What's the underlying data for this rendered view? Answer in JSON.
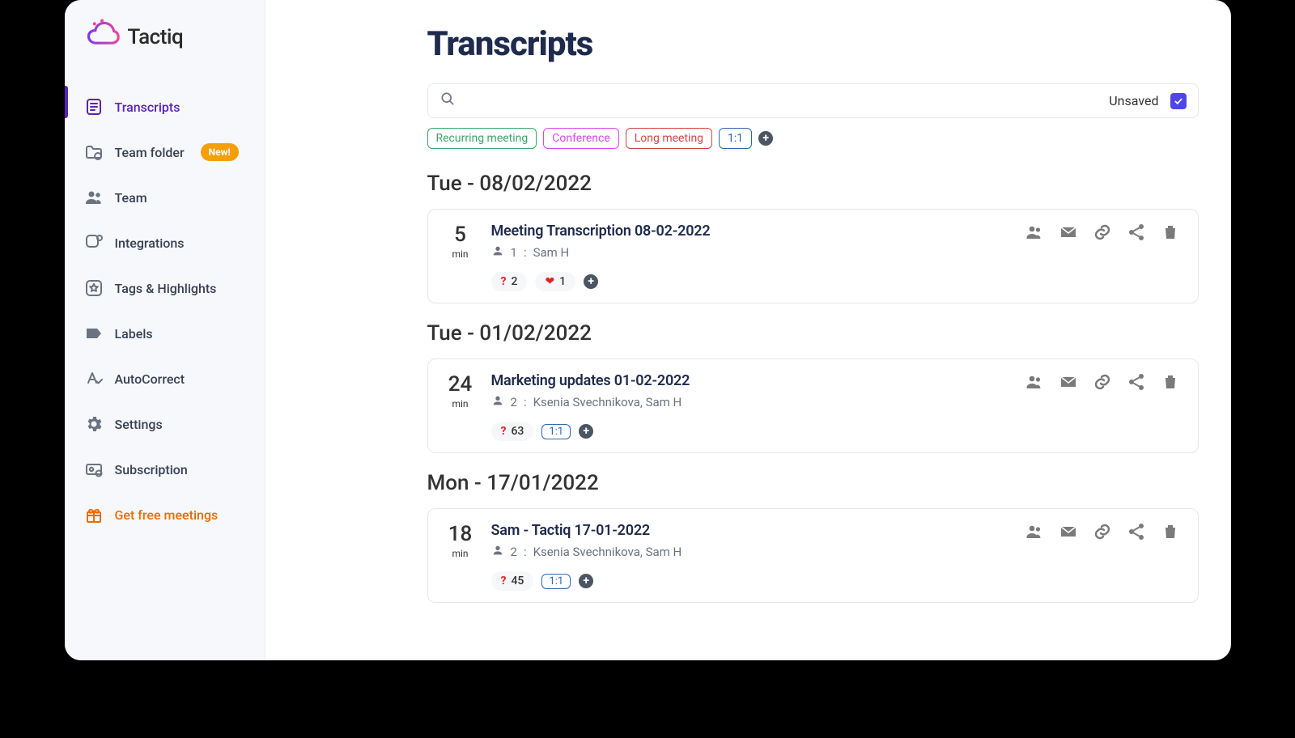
{
  "brand": {
    "name": "Tactiq"
  },
  "sidebar": {
    "items": [
      {
        "label": "Transcripts"
      },
      {
        "label": "Team folder",
        "badge": "New!"
      },
      {
        "label": "Team"
      },
      {
        "label": "Integrations"
      },
      {
        "label": "Tags & Highlights"
      },
      {
        "label": "Labels"
      },
      {
        "label": "AutoCorrect"
      },
      {
        "label": "Settings"
      },
      {
        "label": "Subscription"
      },
      {
        "label": "Get free meetings"
      }
    ]
  },
  "page": {
    "title": "Transcripts"
  },
  "search": {
    "placeholder": "",
    "unsaved_label": "Unsaved",
    "unsaved_checked": true
  },
  "filters": [
    {
      "label": "Recurring meeting",
      "color": "green"
    },
    {
      "label": "Conference",
      "color": "pink"
    },
    {
      "label": "Long meeting",
      "color": "red"
    },
    {
      "label": "1:1",
      "color": "blue"
    }
  ],
  "days": [
    {
      "heading": "Tue - 08/02/2022",
      "cards": [
        {
          "duration": "5",
          "duration_unit": "min",
          "title": "Meeting Transcription 08-02-2022",
          "participants_count": "1",
          "participants": "Sam H",
          "questions": "2",
          "hearts": "1"
        }
      ]
    },
    {
      "heading": "Tue - 01/02/2022",
      "cards": [
        {
          "duration": "24",
          "duration_unit": "min",
          "title": "Marketing updates 01-02-2022",
          "participants_count": "2",
          "participants": "Ksenia Svechnikova, Sam H",
          "questions": "63",
          "label": "1:1"
        }
      ]
    },
    {
      "heading": "Mon - 17/01/2022",
      "cards": [
        {
          "duration": "18",
          "duration_unit": "min",
          "title": "Sam - Tactiq 17-01-2022",
          "participants_count": "2",
          "participants": "Ksenia Svechnikova, Sam H",
          "questions": "45",
          "label": "1:1"
        }
      ]
    }
  ]
}
